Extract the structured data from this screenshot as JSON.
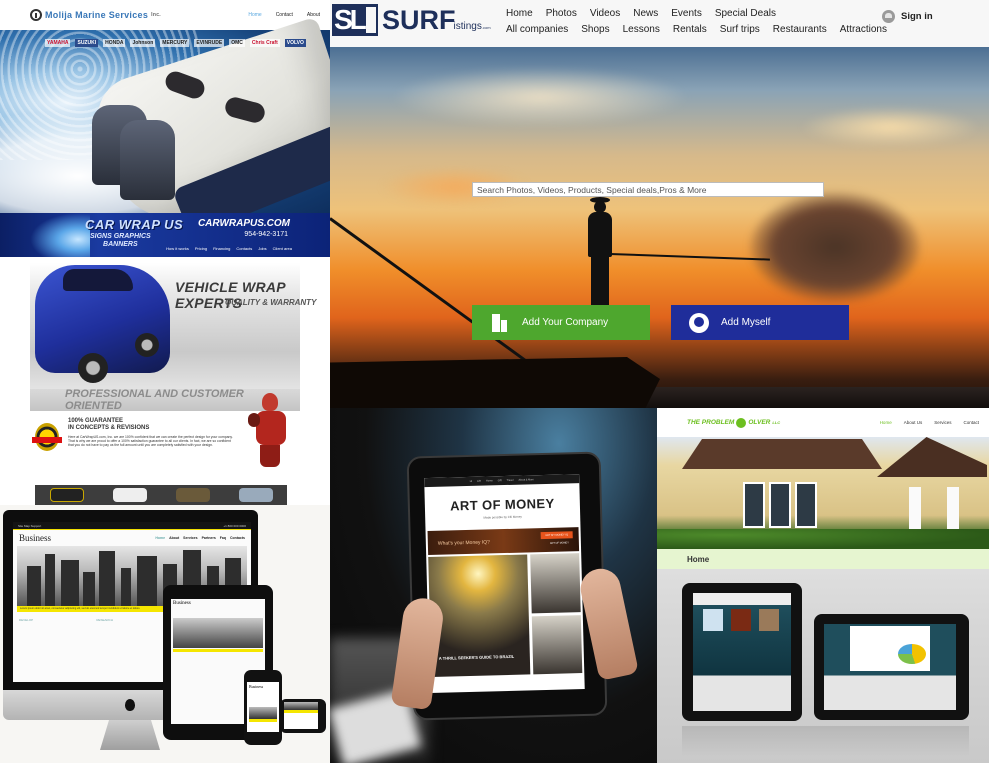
{
  "marine": {
    "logo_text": "Molija Marine Services",
    "logo_suffix": "Inc.",
    "nav": [
      "Home",
      "Contact",
      "About"
    ],
    "brands": [
      "YAMAHA",
      "SUZUKI",
      "HONDA",
      "Johnson",
      "MERCURY",
      "EVINRUDE",
      "OMC",
      "Chris Craft",
      "VOLVO"
    ]
  },
  "carwrap": {
    "brand": "CAR WRAP US",
    "sub_line1": "SIGNS GRAPHICS",
    "sub_line2": "BANNERS",
    "site": "CARWRAPUS.COM",
    "phone": "954-942-3171",
    "nav": [
      "How it works",
      "Pricing",
      "Financing",
      "Contacts",
      "Jobs",
      "Client area"
    ],
    "headline": "VEHICLE WRAP EXPERTS",
    "subheadline": "QUALITY & WARRANTY",
    "tagline": "PROFESSIONAL AND CUSTOMER ORIENTED",
    "guarantee_line1": "100% GUARANTEE",
    "guarantee_line2": "IN CONCEPTS & REVISIONS",
    "guarantee_text": "Here at CarWrapUS.com, Inc. we are 100% confident that we can create the perfect design for your company. That is why we are proud to offer a 100% satisfaction guarantee to all our clients. In fact, we are so confident that you do not have to pay us the full amount until you are completely satisfied with your design."
  },
  "business": {
    "topbar_left": "Site Map   Support",
    "topbar_right": "+1 800 000 0000",
    "title": "Business",
    "nav": [
      "Home",
      "About",
      "Services",
      "Partners",
      "Faq",
      "Contacts"
    ],
    "ticker": "Lorem ipsum dolor sit amet, consectetur adipiscing elit, sed do eiusmod tempor incididunt ut labore et dolore",
    "columns": [
      "DEVELOP",
      "RESEARCH",
      "COMPLETE"
    ],
    "mobile_nav": [
      "Home",
      "About",
      "Services",
      "Partners",
      "Faq",
      "Contacts"
    ]
  },
  "surf": {
    "logo_mark": "SL",
    "logo_word": "SURF",
    "logo_suffix": "istings",
    "logo_tld": ".com",
    "nav_row1": [
      "Home",
      "Photos",
      "Videos",
      "News",
      "Events",
      "Special Deals"
    ],
    "nav_row2": [
      "All companies",
      "Shops",
      "Lessons",
      "Rentals",
      "Surf trips",
      "Restaurants",
      "Attractions"
    ],
    "signin_label": "Sign in",
    "search_placeholder": "Search Photos, Videos, Products, Special deals,Pros & More",
    "add_company_label": "Add Your Company",
    "add_myself_label": "Add Myself",
    "colors": {
      "green_button": "#4ea72e",
      "blue_button": "#1f2d9a",
      "brand_navy": "#1e2f5a"
    }
  },
  "money": {
    "nav": [
      "Hi",
      "Life",
      "Home",
      "Gift",
      "Travel",
      "About & More"
    ],
    "title": "ART OF MONEY",
    "subtitle": "Made possible by Citi Money",
    "ad_text": "What's your Money IQ?",
    "ad_button": "GET MY MONEY IQ",
    "ad_button2": "ART OF MONEY",
    "feature_caption": "A THRILL SEEKER'S GUIDE TO BRAZIL"
  },
  "problem": {
    "logo_text_a": "THE PROBLEM",
    "logo_text_b": "OLVER",
    "logo_suffix": "LLC",
    "nav": [
      "Home",
      "About Us",
      "Services",
      "Contact"
    ],
    "page_heading": "Home"
  }
}
